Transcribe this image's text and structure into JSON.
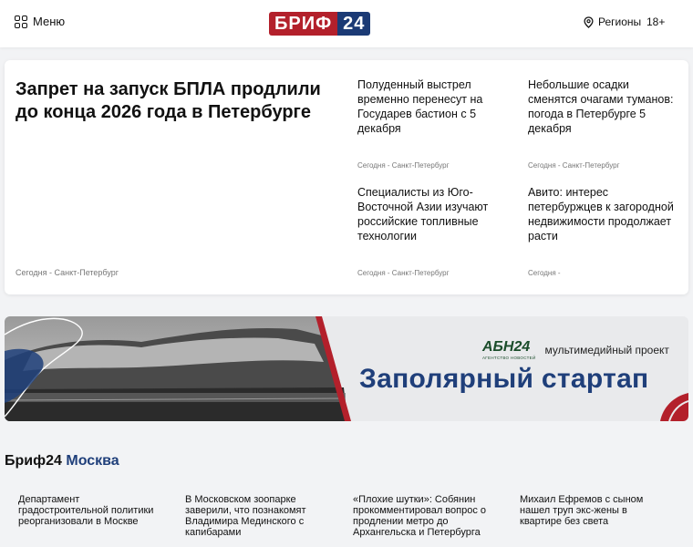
{
  "header": {
    "menu_label": "Меню",
    "logo_left": "БРИФ",
    "logo_right": "24",
    "regions_label": "Регионы",
    "age_rating": "18+"
  },
  "lead": {
    "title": "Запрет на запуск БПЛА продлили до конца 2026 года в Петербурге",
    "meta": "Сегодня - Санкт-Петербург"
  },
  "news": [
    {
      "title": "Полуденный выстрел временно перенесут на Государев бастион с 5 декабря",
      "meta": "Сегодня - Санкт-Петербург"
    },
    {
      "title": "Небольшие осадки сменятся очагами туманов: погода в Петербурге 5 декабря",
      "meta": "Сегодня - Санкт-Петербург"
    },
    {
      "title": "Специалисты из Юго-Восточной Азии изучают российские топливные технологии",
      "meta": "Сегодня - Санкт-Петербург"
    },
    {
      "title": "Авито: интерес петербуржцев к загородной недвижимости продолжает расти",
      "meta": "Сегодня -"
    }
  ],
  "banner": {
    "brand_logo": "АБН24",
    "brand_sub": "АГЕНТСТВО НОВОСТЕЙ",
    "brand_text": "мультимедийный проект",
    "title": "Заполярный стартап"
  },
  "section": {
    "prefix": "Бриф24",
    "accent": "Москва"
  },
  "bottom_news": [
    {
      "title": "Департамент градостроительной политики реорганизовали в Москве"
    },
    {
      "title": "В Московском зоопарке заверили, что познакомят Владимира Мединского с капибарами"
    },
    {
      "title": "«Плохие шутки»: Собянин прокомментировал вопрос о продлении метро до Архангельска и Петербурга"
    },
    {
      "title": "Михаил Ефремов с сыном нашел труп экс-жены в квартире без света"
    }
  ],
  "colors": {
    "brand_red": "#b3202b",
    "brand_blue": "#1b3a75",
    "accent_blue": "#1f3f7a"
  }
}
